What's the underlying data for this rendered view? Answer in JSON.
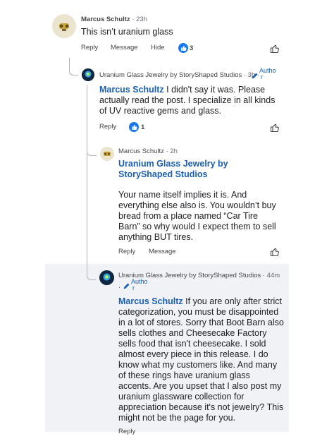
{
  "comments": [
    {
      "author": "Marcus Schultz",
      "time": "· 23h",
      "text": "This isn’t uranium glass",
      "actions": [
        "Reply",
        "Message",
        "Hide"
      ],
      "likes": "3"
    },
    {
      "author": "Uranium Glass Jewelry by StoryShaped Studios",
      "time": "· 3h ·",
      "badge_top": "Autho",
      "badge_bottom": "r",
      "mention": "Marcus Schultz",
      "text": " I didn't say it was. Please actually read the post. I specialize in all kinds of UV reactive gems and glass.",
      "actions": [
        "Reply"
      ],
      "likes": "1"
    },
    {
      "author": "Marcus Schultz",
      "time": "· 2h",
      "mention": "Uranium Glass Jewelry by StoryShaped Studios",
      "text": "Your name itself implies it is. And everything else also is. You wouldn’t buy bread from a place named “Car Tire Barn” so why would I expect them to sell anything BUT tires.",
      "actions": [
        "Reply",
        "Message"
      ]
    },
    {
      "author": "Uranium Glass Jewelry by StoryShaped Studios",
      "time": "· 44m",
      "badge_top": "Autho",
      "badge_bottom": "r",
      "mention": "Marcus Schultz",
      "text": "  If you are only after strict categorization, you must be disappointed in a lot of stores. Sorry that Boot Barn also sells clothes and Cheesecake Factory sells food that isn't cheesecake. I sold almost every piece in this release. I do know what my customers like. And many of these rings have uranium glass accents. Are you upset that I also post my uranium glassware collection for appreciation because it's not jewelry? This might not be the page for you.",
      "actions": [
        "Reply"
      ]
    }
  ],
  "colors": {
    "link": "#1a5fb4",
    "like": "#1877f2",
    "highlight": "#f0f2f5"
  }
}
